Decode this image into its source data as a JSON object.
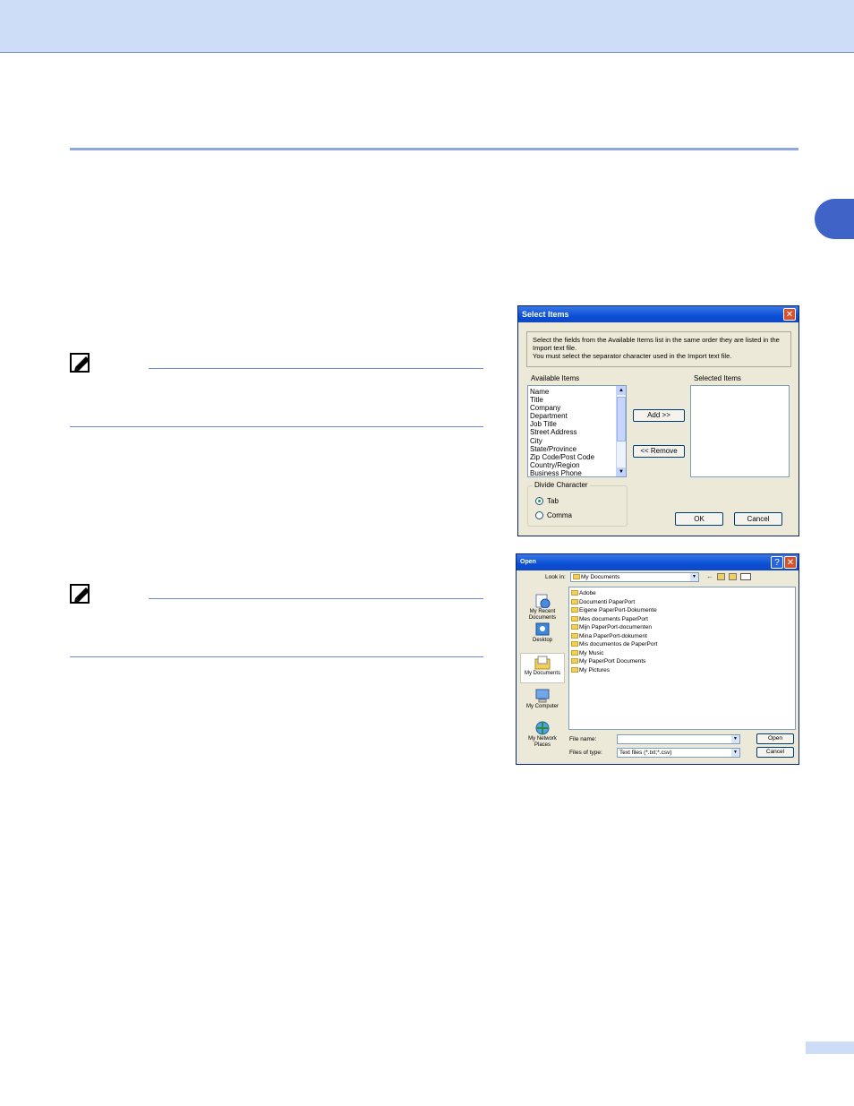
{
  "select_items": {
    "title": "Select Items",
    "instruction": "Select the fields from the Available Items list in the same order they are listed in the Import text file.\nYou must select the separator character used in the Import text file.",
    "available_label": "Available Items",
    "selected_label": "Selected Items",
    "available_items": [
      "Name",
      "Title",
      "Company",
      "Department",
      "Job Title",
      "Street Address",
      "City",
      "State/Province",
      "Zip Code/Post Code",
      "Country/Region",
      "Business Phone"
    ],
    "add_button": "Add >>",
    "remove_button": "<< Remove",
    "divide_label": "Divide Character",
    "tab_option": "Tab",
    "comma_option": "Comma",
    "ok_button": "OK",
    "cancel_button": "Cancel"
  },
  "open_dialog": {
    "title": "Open",
    "look_in_label": "Look in:",
    "look_in_value": "My Documents",
    "places": [
      "My Recent Documents",
      "Desktop",
      "My Documents",
      "My Computer",
      "My Network Places"
    ],
    "files": [
      "Adobe",
      "Documenti PaperPort",
      "Eigene PaperPort-Dokumente",
      "Mes documents PaperPort",
      "Mijn PaperPort-documenten",
      "Mina PaperPort-dokument",
      "Mis documentos de PaperPort",
      "My Music",
      "My PaperPort Documents",
      "My Pictures"
    ],
    "file_name_label": "File name:",
    "file_name_value": "",
    "files_of_type_label": "Files of type:",
    "files_of_type_value": "Text files (*.txt;*.csv)",
    "open_button": "Open",
    "cancel_button": "Cancel"
  },
  "colors": {
    "header_band": "#cddcf7",
    "accent": "#3f63c6",
    "rule": "#8fa8e3"
  }
}
